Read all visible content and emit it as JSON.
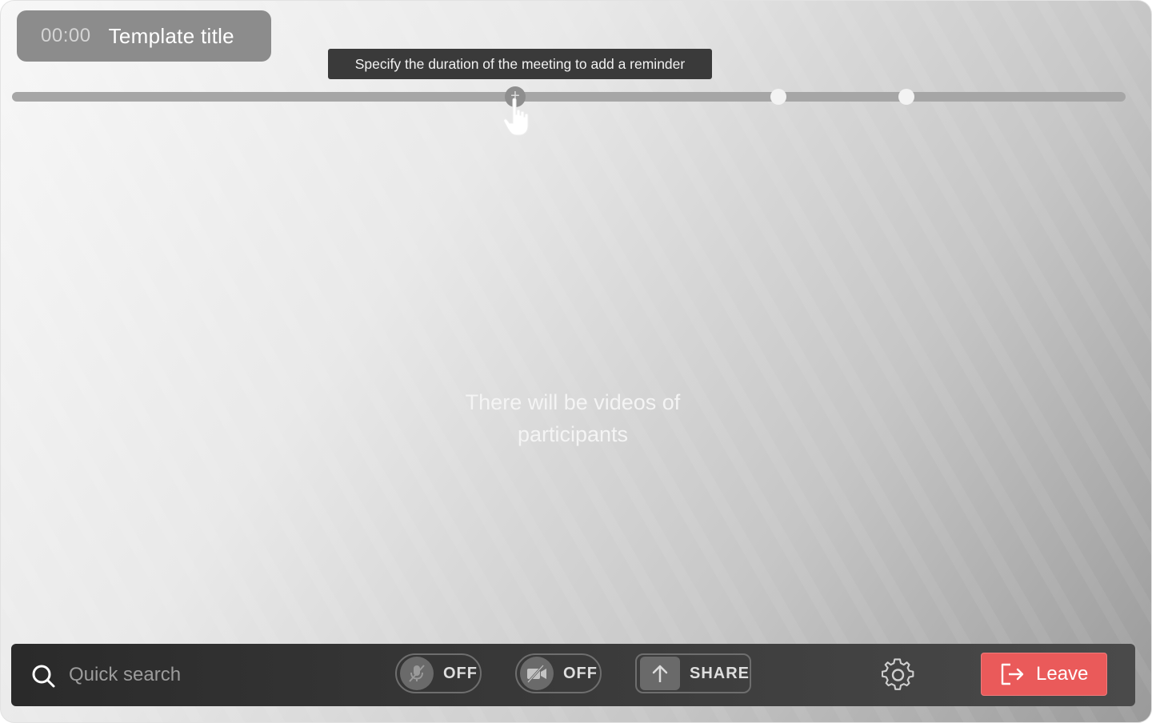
{
  "header": {
    "timer": "00:00",
    "title": "Template title"
  },
  "timeline": {
    "tooltip": "Specify the duration of the meeting to add a reminder",
    "add_marker_icon": "plus-icon",
    "cursor_icon": "hand-pointer-icon"
  },
  "main": {
    "placeholder": "There will be videos of participants"
  },
  "toolbar": {
    "search_placeholder": "Quick search",
    "mic": {
      "icon": "mic-off-icon",
      "label": "OFF"
    },
    "camera": {
      "icon": "camera-off-icon",
      "label": "OFF"
    },
    "share": {
      "icon": "arrow-up-icon",
      "label": "SHARE"
    },
    "settings_icon": "gear-icon",
    "leave": {
      "icon": "exit-icon",
      "label": "Leave"
    }
  },
  "colors": {
    "leave_button": "#ea5a5a",
    "toolbar_bg": "#2a2a2a",
    "tooltip_bg": "#3a3a3a"
  }
}
